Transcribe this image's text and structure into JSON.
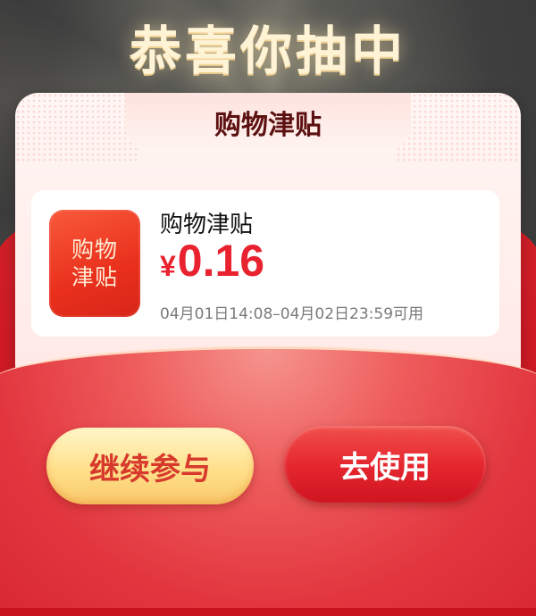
{
  "headline": "恭喜你抽中",
  "card": {
    "tab_label": "购物津贴",
    "coupon": {
      "icon_line1": "购物",
      "icon_line2": "津贴",
      "title": "购物津贴",
      "currency": "¥",
      "amount": "0.16",
      "validity": "04月01日14:08–04月02日23:59可用"
    }
  },
  "buttons": {
    "continue_label": "继续参与",
    "use_label": "去使用"
  },
  "colors": {
    "accent_red": "#e8232f",
    "gold": "#ffe08a"
  }
}
